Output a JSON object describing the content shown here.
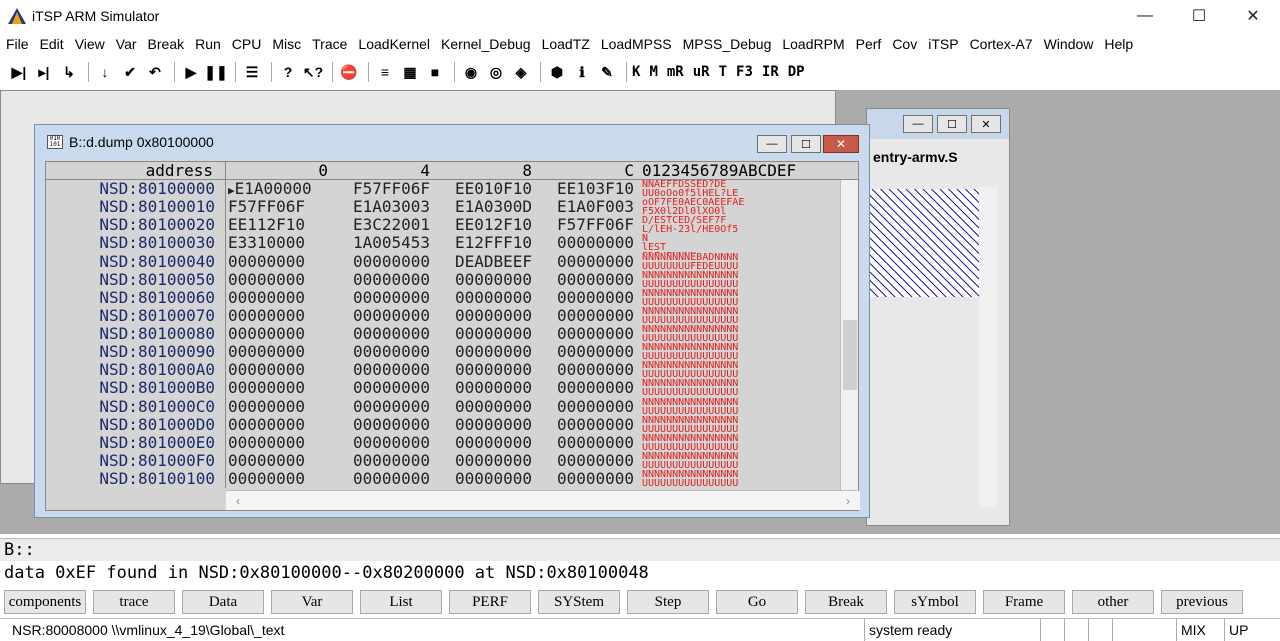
{
  "app": {
    "title": "iTSP ARM Simulator"
  },
  "window_controls": {
    "minimize": "—",
    "maximize": "☐",
    "close": "✕"
  },
  "menu": [
    "File",
    "Edit",
    "View",
    "Var",
    "Break",
    "Run",
    "CPU",
    "Misc",
    "Trace",
    "LoadKernel",
    "Kernel_Debug",
    "LoadTZ",
    "LoadMPSS",
    "MPSS_Debug",
    "LoadRPM",
    "Perf",
    "Cov",
    "iTSP",
    "Cortex-A7",
    "Window",
    "Help"
  ],
  "toolbar": {
    "text_buttons": [
      "K",
      "M",
      "mR",
      "uR",
      "T",
      "F3",
      "IR",
      "DP"
    ],
    "icons": [
      {
        "name": "step-over-icon",
        "glyph": "▶|"
      },
      {
        "name": "step-into-icon",
        "glyph": "▸|"
      },
      {
        "name": "step-out-icon",
        "glyph": "↳"
      },
      {
        "name": "step-down-icon",
        "glyph": "↓"
      },
      {
        "name": "return-icon",
        "glyph": "✔"
      },
      {
        "name": "undo-icon",
        "glyph": "↶"
      },
      {
        "name": "go-icon",
        "glyph": "▶"
      },
      {
        "name": "pause-icon",
        "glyph": "❚❚"
      },
      {
        "name": "list-icon",
        "glyph": "☰"
      },
      {
        "name": "help-icon",
        "glyph": "?"
      },
      {
        "name": "context-help-icon",
        "glyph": "↖?"
      },
      {
        "name": "stop-icon",
        "glyph": "⛔"
      },
      {
        "name": "source-list-icon",
        "glyph": "≡"
      },
      {
        "name": "dump-icon",
        "glyph": "▦"
      },
      {
        "name": "chip-icon",
        "glyph": "■"
      },
      {
        "name": "watch-icon",
        "glyph": "◉"
      },
      {
        "name": "view-icon",
        "glyph": "◎"
      },
      {
        "name": "perf-icon",
        "glyph": "◈"
      },
      {
        "name": "cube-icon",
        "glyph": "⬢"
      },
      {
        "name": "info-icon",
        "glyph": "ℹ"
      },
      {
        "name": "wrench-icon",
        "glyph": "✎"
      }
    ]
  },
  "background_window": {
    "tab_label": "entry-armv.S"
  },
  "dump_window": {
    "title": "B::d.dump 0x80100000",
    "header": {
      "address": "address",
      "col0": "0",
      "col4": "4",
      "col8": "8",
      "colc": "C",
      "ascii": "0123456789ABCDEF"
    },
    "rows": [
      {
        "addr": "NSD:80100000",
        "v": [
          "E1A00000",
          "F57FF06F",
          "EE010F10",
          "EE103F10"
        ],
        "a": "NNAEFFDSSED?DE UU0oOo0f5lHEL?LE",
        "marker": "▶"
      },
      {
        "addr": "NSD:80100010",
        "v": [
          "F57FF06F",
          "E1A03003",
          "E1A0300D",
          "E1A0F003"
        ],
        "a": "oOF7FE0AEC0AEEFAE F5X0l2Dl0lXO0l"
      },
      {
        "addr": "NSD:80100020",
        "v": [
          "EE112F10",
          "E3C22001",
          "EE012F10",
          "F57FF06F"
        ],
        "a": "D/ESTCED/SEF7F L/lEH-23l/HE0Of5"
      },
      {
        "addr": "NSD:80100030",
        "v": [
          "E3310000",
          "1A005453",
          "E12FFF10",
          "00000000"
        ],
        "a": "N lEST SDF/ENNNN UJSTUCLF/lUUUU"
      },
      {
        "addr": "NSD:80100040",
        "v": [
          "00000000",
          "00000000",
          "DEADBEEF",
          "00000000"
        ],
        "a": "NNNNNNNNEBADNNNN UUUUUUUUFEDEUUUU"
      },
      {
        "addr": "NSD:80100050",
        "v": [
          "00000000",
          "00000000",
          "00000000",
          "00000000"
        ],
        "a": "NNNNNNNNNNNNNNNN UUUUUUUUUUUUUUUU"
      },
      {
        "addr": "NSD:80100060",
        "v": [
          "00000000",
          "00000000",
          "00000000",
          "00000000"
        ],
        "a": "NNNNNNNNNNNNNNNN UUUUUUUUUUUUUUUU"
      },
      {
        "addr": "NSD:80100070",
        "v": [
          "00000000",
          "00000000",
          "00000000",
          "00000000"
        ],
        "a": "NNNNNNNNNNNNNNNN UUUUUUUUUUUUUUUU"
      },
      {
        "addr": "NSD:80100080",
        "v": [
          "00000000",
          "00000000",
          "00000000",
          "00000000"
        ],
        "a": "NNNNNNNNNNNNNNNN UUUUUUUUUUUUUUUU"
      },
      {
        "addr": "NSD:80100090",
        "v": [
          "00000000",
          "00000000",
          "00000000",
          "00000000"
        ],
        "a": "NNNNNNNNNNNNNNNN UUUUUUUUUUUUUUUU"
      },
      {
        "addr": "NSD:801000A0",
        "v": [
          "00000000",
          "00000000",
          "00000000",
          "00000000"
        ],
        "a": "NNNNNNNNNNNNNNNN UUUUUUUUUUUUUUUU"
      },
      {
        "addr": "NSD:801000B0",
        "v": [
          "00000000",
          "00000000",
          "00000000",
          "00000000"
        ],
        "a": "NNNNNNNNNNNNNNNN UUUUUUUUUUUUUUUU"
      },
      {
        "addr": "NSD:801000C0",
        "v": [
          "00000000",
          "00000000",
          "00000000",
          "00000000"
        ],
        "a": "NNNNNNNNNNNNNNNN UUUUUUUUUUUUUUUU"
      },
      {
        "addr": "NSD:801000D0",
        "v": [
          "00000000",
          "00000000",
          "00000000",
          "00000000"
        ],
        "a": "NNNNNNNNNNNNNNNN UUUUUUUUUUUUUUUU"
      },
      {
        "addr": "NSD:801000E0",
        "v": [
          "00000000",
          "00000000",
          "00000000",
          "00000000"
        ],
        "a": "NNNNNNNNNNNNNNNN UUUUUUUUUUUUUUUU"
      },
      {
        "addr": "NSD:801000F0",
        "v": [
          "00000000",
          "00000000",
          "00000000",
          "00000000"
        ],
        "a": "NNNNNNNNNNNNNNNN UUUUUUUUUUUUUUUU"
      },
      {
        "addr": "NSD:80100100",
        "v": [
          "00000000",
          "00000000",
          "00000000",
          "00000000"
        ],
        "a": "NNNNNNNNNNNNNNNN UUUUUUUUUUUUUUUU"
      }
    ]
  },
  "command": {
    "prompt": "B::",
    "output": "data 0xEF found in NSD:0x80100000--0x80200000 at NSD:0x80100048"
  },
  "softkeys": [
    "components",
    "trace",
    "Data",
    "Var",
    "List",
    "PERF",
    "SYStem",
    "Step",
    "Go",
    "Break",
    "sYmbol",
    "Frame",
    "other",
    "previous"
  ],
  "status": {
    "location": "NSR:80008000  \\\\vmlinux_4_19\\Global\\_text",
    "state": "system ready",
    "mode": "MIX",
    "direction": "UP"
  },
  "colors": {
    "ascii_text": "#e02020",
    "address_text": "#1a2a6a",
    "close_button": "#c85a4a"
  }
}
